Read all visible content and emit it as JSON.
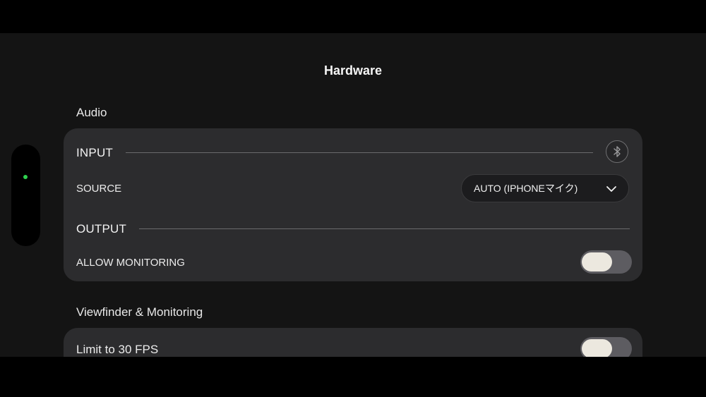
{
  "header": {
    "title": "Hardware"
  },
  "audio": {
    "section_label": "Audio",
    "input_title": "INPUT",
    "bluetooth_icon": "bluetooth-icon",
    "source_label": "SOURCE",
    "source_value": "AUTO (IPHONEマイク)",
    "output_title": "OUTPUT",
    "allow_monitoring_label": "ALLOW MONITORING",
    "allow_monitoring_on": false
  },
  "viewfinder": {
    "section_label": "Viewfinder & Monitoring",
    "limit_fps_label": "Limit to 30 FPS",
    "limit_fps_on": false
  },
  "colors": {
    "background": "#141414",
    "card": "#2c2c2e",
    "status_dot": "#2fd14f",
    "toggle_track": "#5d5c61",
    "toggle_knob": "#ece8df"
  }
}
